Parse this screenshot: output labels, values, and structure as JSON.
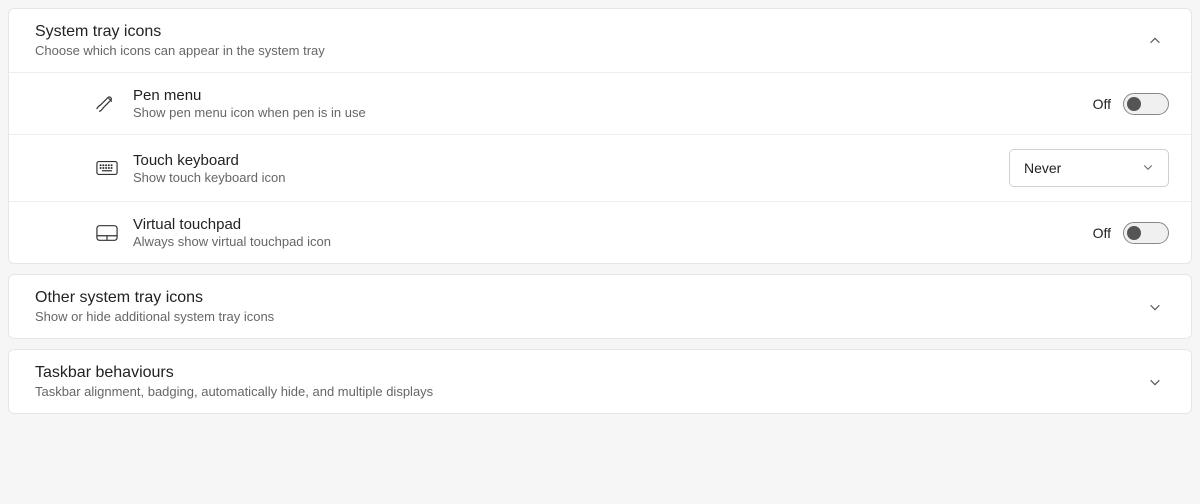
{
  "sections": {
    "system_tray": {
      "title": "System tray icons",
      "subtitle": "Choose which icons can appear in the system tray",
      "expanded": true,
      "items": {
        "pen_menu": {
          "title": "Pen menu",
          "desc": "Show pen menu icon when pen is in use",
          "toggle_state_label": "Off"
        },
        "touch_keyboard": {
          "title": "Touch keyboard",
          "desc": "Show touch keyboard icon",
          "select_value": "Never"
        },
        "virtual_touchpad": {
          "title": "Virtual touchpad",
          "desc": "Always show virtual touchpad icon",
          "toggle_state_label": "Off"
        }
      }
    },
    "other_tray": {
      "title": "Other system tray icons",
      "subtitle": "Show or hide additional system tray icons",
      "expanded": false
    },
    "taskbar_behaviours": {
      "title": "Taskbar behaviours",
      "subtitle": "Taskbar alignment, badging, automatically hide, and multiple displays",
      "expanded": false
    }
  }
}
